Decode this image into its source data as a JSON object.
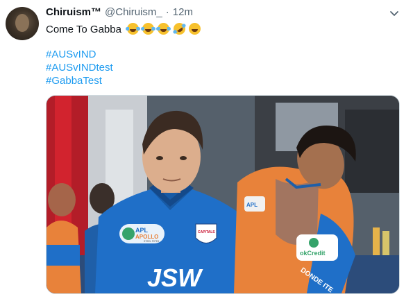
{
  "tweet": {
    "author_name": "Chiruism™",
    "handle": "@Chiruism_",
    "separator": "·",
    "time": "12m",
    "text": "Come To Gabba",
    "emojis": [
      "face-with-tears-of-joy",
      "face-with-tears-of-joy",
      "face-with-tears-of-joy",
      "rolling-on-floor-laughing",
      "grinning-face"
    ],
    "hashtags": [
      "#AUSvIND",
      "#AUSvINDtest",
      "#GabbaTest"
    ]
  },
  "image": {
    "jersey_sponsor": "JSW",
    "sponsor_patch": "APOLLO",
    "sponsor_patch_prefix": "APL",
    "sponsor_patch_sub": "STEEL PIPES",
    "team_badge": "CAPITALS",
    "orange_patch": "okCredit",
    "sleeve_text": "DONDE ITE",
    "orange_chest": "APL"
  },
  "colors": {
    "link": "#1d9bf0",
    "secondary_text": "#536471",
    "jersey_blue": "#1f6fc8",
    "jersey_orange": "#e8823a"
  }
}
